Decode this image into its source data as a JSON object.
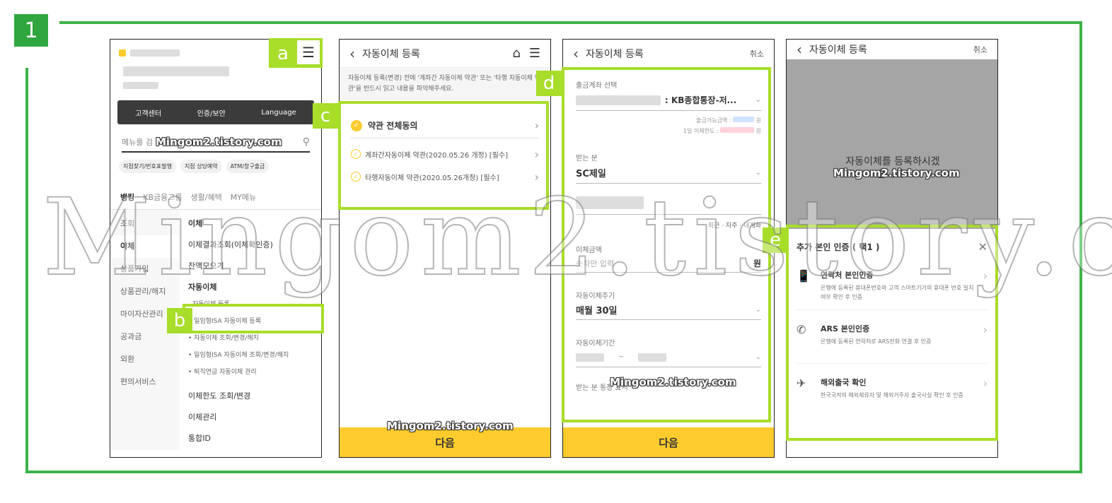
{
  "step_number": "1",
  "labels": {
    "a": "a",
    "b": "b",
    "c": "c",
    "d": "d",
    "e": "e"
  },
  "watermark": "Mingom2.tistory.com",
  "screen1": {
    "quick_menu": [
      "고객센터",
      "인증/보안",
      "Language"
    ],
    "search_placeholder": "메뉴를 검",
    "chips": [
      "지점찾기/번호표발행",
      "지점 상담예약",
      "ATM/창구출금"
    ],
    "tabs": [
      "뱅킹",
      "KB금융그룹",
      "생활/혜택",
      "MY메뉴"
    ],
    "left_menu": [
      "조회",
      "이체",
      "상품가입",
      "상품관리/해지",
      "마이자산관리",
      "공과금",
      "외환",
      "편의서비스"
    ],
    "right_menu": {
      "transfer": "이체",
      "transfer_check": "이체결과조회(이체확인증)",
      "balance": "잔액모으기",
      "auto_transfer": "자동이체",
      "auto_register": "자동이체 등록",
      "sub1": "• 일임형ISA 자동이체 등록",
      "sub2": "• 자동이체 조회/변경/해지",
      "sub3": "• 일임형ISA 자동이체 조회/변경/해지",
      "sub4": "• 퇴직연금 자동이체 관리",
      "limit": "이체한도 조회/변경",
      "manage": "이체관리",
      "extra": "통합ID"
    }
  },
  "screen2": {
    "title": "자동이체 등록",
    "notice": "자동이체 등록(변경) 전에 '계좌간 자동이체 약관' 또는 '타행 자동이체 약관'을 반드시 읽고 내용을 파악해주세요.",
    "agree_all": "약관 전체동의",
    "term1": "계좌간자동이체 약관(2020.05.26 개정) [필수]",
    "term2": "타행자동이체 약관(2020.05.26개정) [필수]",
    "next": "다음"
  },
  "screen3": {
    "title": "자동이체 등록",
    "cancel": "취소",
    "withdraw_label": "출금계좌 선택",
    "withdraw_value": ": KB종합통장-저...",
    "available": "출금가능금액 :",
    "daily_limit": "1일 이체한도 :",
    "won": "원",
    "receiver_label": "받는 분",
    "receiver_value": "SC제일",
    "recent": "최근 · 자주 · 내계좌",
    "amount_label": "이체금액",
    "amount_placeholder": "숫자만 입력",
    "cycle_label": "자동이체주기",
    "cycle_value": "매월 30일",
    "period_label": "자동이체기간",
    "period_sep": "~",
    "passbook_label": "받는 분 통장 표시",
    "next": "다음"
  },
  "screen4": {
    "title": "자동이체 등록",
    "cancel": "취소",
    "overlay_text": "자동이체를 등록하시겠습니까?",
    "sheet_title": "추가 본인 인증 ( 택1 )",
    "options": [
      {
        "title": "연락처 본인인증",
        "desc": "은행에 등록된 휴대폰번호와 고객 스마트기기의 휴대폰 번호 일치여부 확인 후 인증",
        "icon": "phone-check-icon"
      },
      {
        "title": "ARS 본인인증",
        "desc": "은행에 등록된 연락처로 ARS전화 연결 후 인증",
        "icon": "ars-call-icon"
      },
      {
        "title": "해외출국 확인",
        "desc": "한국국적의 해외체류자 및 해외거주자 출국사실 확인 후 인증",
        "icon": "airplane-icon"
      }
    ]
  },
  "colors": {
    "green": "#3db34a",
    "lime": "#a8dd2a",
    "yellow": "#fdcb2d"
  }
}
